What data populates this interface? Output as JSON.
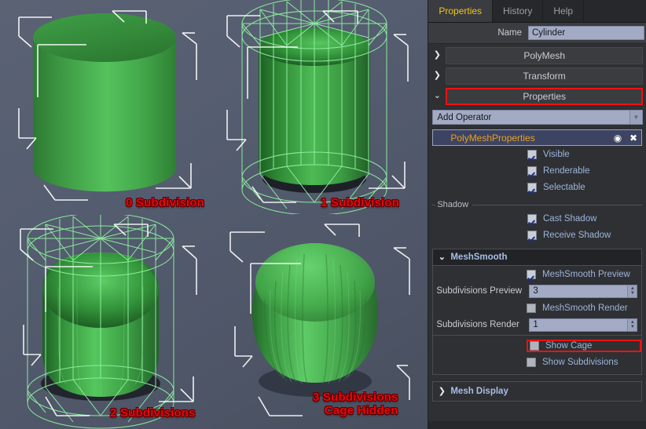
{
  "viewport": {
    "labels": [
      {
        "id": "label-0",
        "text": "0 Subdivision"
      },
      {
        "id": "label-1",
        "text": "1 Subdivision"
      },
      {
        "id": "label-2",
        "text": "2 Subdivisions"
      },
      {
        "id": "label-3",
        "text": "3 Subdivisions\nCage Hidden"
      }
    ],
    "colors": {
      "background": "#555d70",
      "mesh_green": "#3faa49",
      "wireframe_green": "#8ef2a0",
      "selection_white": "#ffffff",
      "annotation_red": "#e8060a"
    }
  },
  "panel": {
    "tabs": [
      {
        "label": "Properties",
        "active": true
      },
      {
        "label": "History",
        "active": false
      },
      {
        "label": "Help",
        "active": false
      }
    ],
    "name_field": {
      "label": "Name",
      "value": "Cylinder",
      "placeholder": "Name"
    },
    "sections": [
      {
        "label": "PolyMesh",
        "expanded": false,
        "arrow": "❯",
        "highlighted": false
      },
      {
        "label": "Transform",
        "expanded": false,
        "arrow": "❯",
        "highlighted": false
      },
      {
        "label": "Properties",
        "expanded": true,
        "arrow": "⌄",
        "highlighted": true
      }
    ],
    "add_operator": {
      "value": "Add Operator",
      "arrow": "▼"
    },
    "operator": {
      "name": "PolyMeshProperties",
      "eye_icon": "◉",
      "close_icon": "✖"
    },
    "toggles": [
      {
        "label": "Visible",
        "checked": true
      },
      {
        "label": "Renderable",
        "checked": true
      },
      {
        "label": "Selectable",
        "checked": true
      }
    ],
    "shadow_group": {
      "label": "Shadow",
      "toggles": [
        {
          "label": "Cast Shadow",
          "checked": true
        },
        {
          "label": "Receive Shadow",
          "checked": true
        }
      ]
    },
    "meshsmooth": {
      "header": "MeshSmooth",
      "arrow": "⌄",
      "preview_toggle": {
        "label": "MeshSmooth Preview",
        "checked": true
      },
      "subdiv_preview": {
        "label": "Subdivisions Preview",
        "value": "3"
      },
      "render_toggle": {
        "label": "MeshSmooth Render",
        "checked": false
      },
      "subdiv_render": {
        "label": "Subdivisions Render",
        "value": "1"
      },
      "show_cage": {
        "label": "Show Cage",
        "checked": false,
        "highlighted": true
      },
      "show_subdivisions": {
        "label": "Show Subdivisions",
        "checked": false,
        "highlighted": false
      },
      "spin_up": "▲",
      "spin_down": "▼"
    },
    "mesh_display": {
      "label": "Mesh Display",
      "arrow": "❯"
    }
  }
}
